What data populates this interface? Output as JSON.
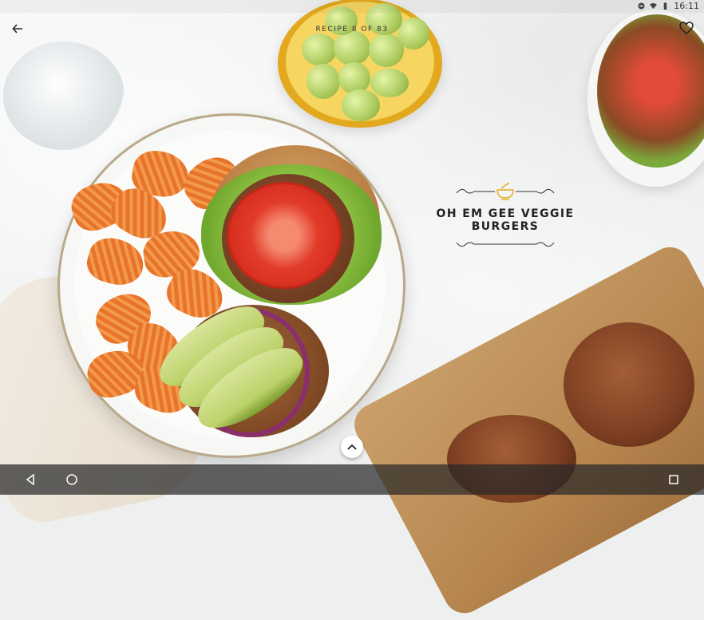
{
  "status_bar": {
    "time": "16:11"
  },
  "header": {
    "recipe_counter": "RECIPE 8 OF 83"
  },
  "recipe": {
    "title": "OH EM GEE VEGGIE BURGERS"
  },
  "icons": {
    "back": "arrow-back-icon",
    "favorite": "heart-outline-icon",
    "expand": "chevron-up-icon",
    "category": "mortar-bowl-icon"
  },
  "colors": {
    "accent": "#e2a91f",
    "text": "#222222",
    "navbar": "#282828"
  }
}
